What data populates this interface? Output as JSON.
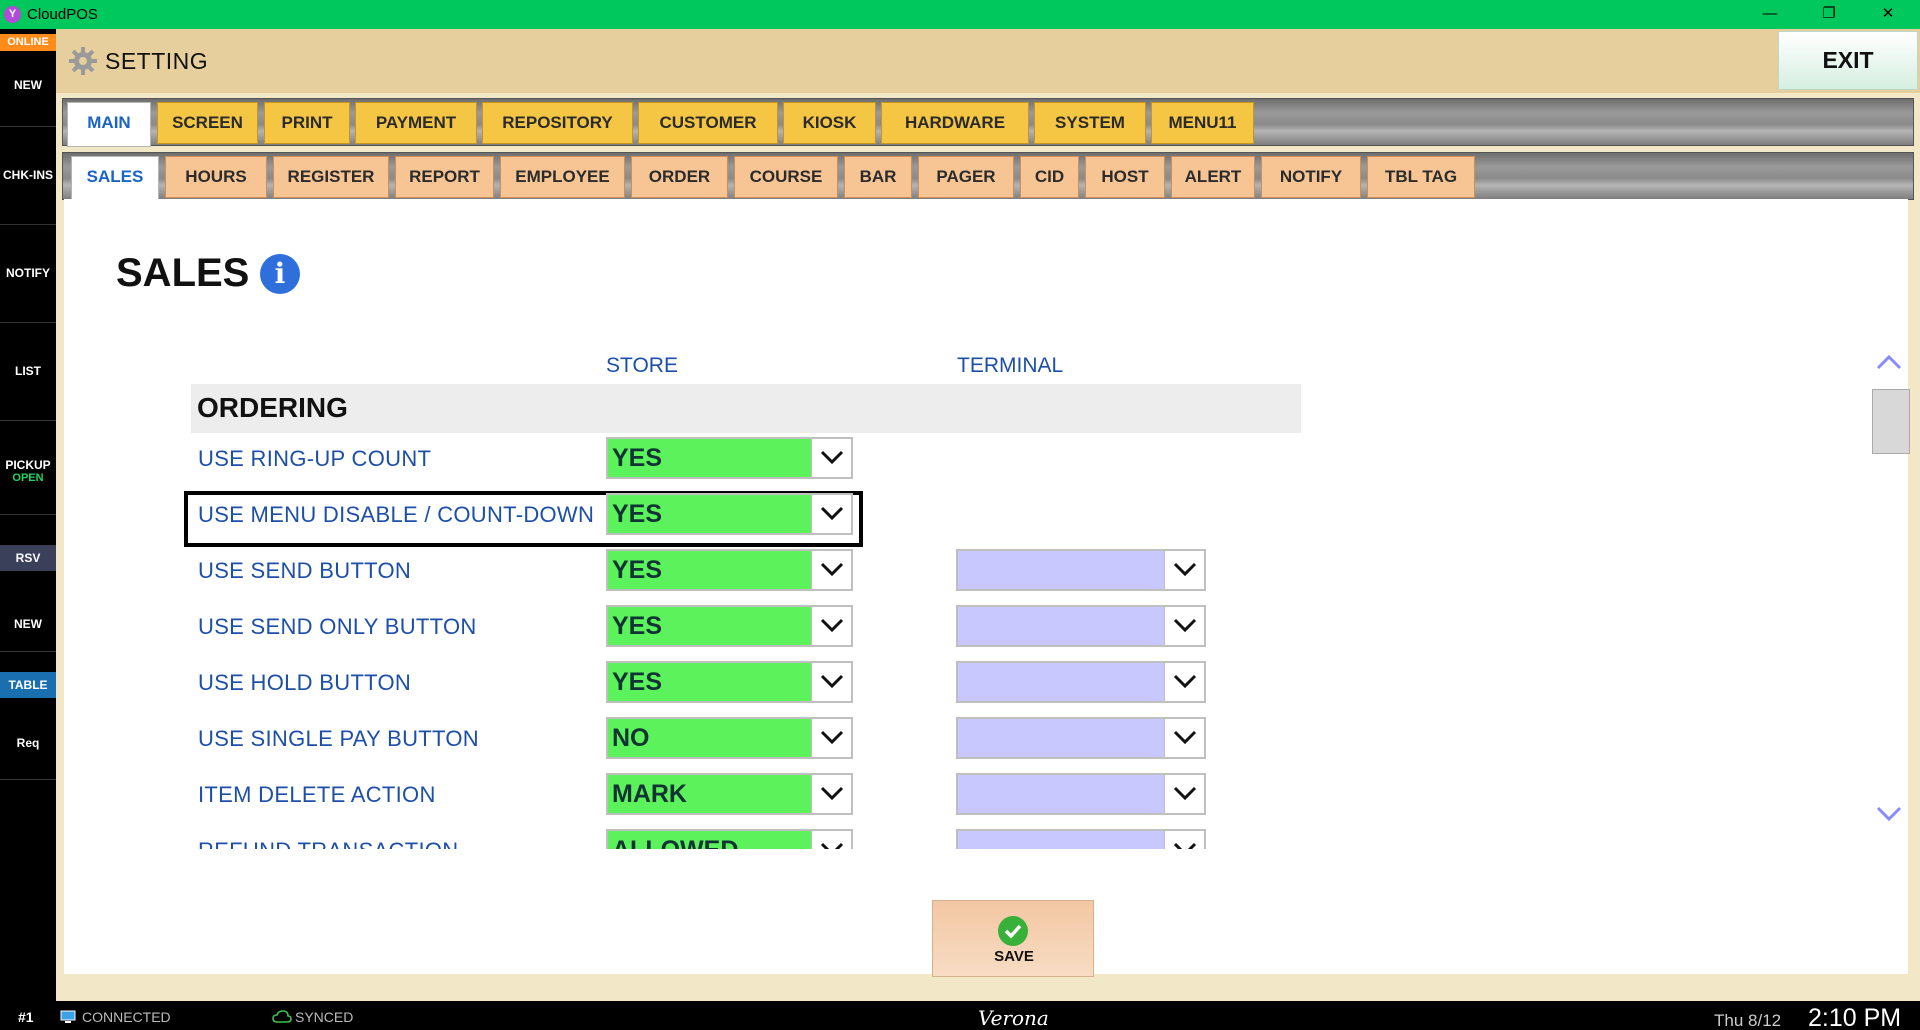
{
  "window": {
    "title": "CloudPOS",
    "app_icon_letter": "Y",
    "minimize": "—",
    "restore": "❐",
    "close": "✕"
  },
  "rail": {
    "online": "ONLINE",
    "items": [
      {
        "label": "NEW",
        "sub": ""
      },
      {
        "label": "CHK-INS",
        "sub": ""
      },
      {
        "label": "NOTIFY",
        "sub": ""
      },
      {
        "label": "LIST",
        "sub": ""
      },
      {
        "label": "PICKUP",
        "sub": "OPEN"
      }
    ],
    "rsv": "RSV",
    "new2": "NEW",
    "table": "TABLE",
    "req": "Req"
  },
  "header": {
    "title": "SETTING",
    "exit": "EXIT"
  },
  "tabs": [
    "MAIN",
    "SCREEN",
    "PRINT",
    "PAYMENT",
    "REPOSITORY",
    "CUSTOMER",
    "KIOSK",
    "HARDWARE",
    "SYSTEM",
    "MENU11"
  ],
  "subtabs": [
    "SALES",
    "HOURS",
    "REGISTER",
    "REPORT",
    "EMPLOYEE",
    "ORDER",
    "COURSE",
    "BAR",
    "PAGER",
    "CID",
    "HOST",
    "ALERT",
    "NOTIFY",
    "TBL TAG"
  ],
  "page": {
    "title": "SALES",
    "info_glyph": "i",
    "col_store": "STORE",
    "col_terminal": "TERMINAL",
    "section": "ORDERING"
  },
  "settings": [
    {
      "label": "USE RING-UP COUNT",
      "store": "YES",
      "terminal": null
    },
    {
      "label": "USE MENU DISABLE / COUNT-DOWN",
      "store": "YES",
      "terminal": null
    },
    {
      "label": "USE SEND BUTTON",
      "store": "YES",
      "terminal": ""
    },
    {
      "label": "USE SEND ONLY BUTTON",
      "store": "YES",
      "terminal": ""
    },
    {
      "label": "USE HOLD BUTTON",
      "store": "YES",
      "terminal": ""
    },
    {
      "label": "USE SINGLE PAY BUTTON",
      "store": "NO",
      "terminal": ""
    },
    {
      "label": "ITEM DELETE ACTION",
      "store": "MARK",
      "terminal": ""
    },
    {
      "label": "REFUND TRANSACTION",
      "store": "ALLOWED",
      "terminal": ""
    }
  ],
  "save_label": "SAVE",
  "status": {
    "station": "#1",
    "connected": "CONNECTED",
    "synced": "SYNCED",
    "location": "Verona",
    "date": "Thu 8/12",
    "time": "2:10 PM"
  }
}
